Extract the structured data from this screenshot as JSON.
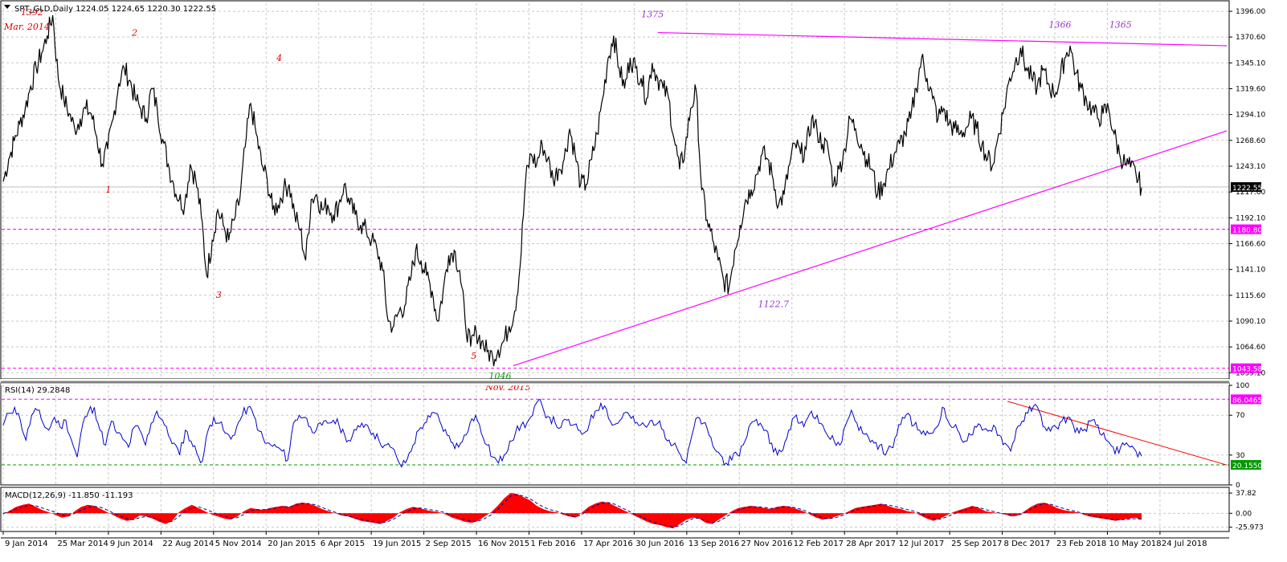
{
  "chart_data": [
    {
      "type": "line",
      "panel": "price",
      "header": "SPT_GLD,Daily  1224.05 1224.65 1220.30 1222.55",
      "ohlc": {
        "open": 1224.05,
        "high": 1224.65,
        "low": 1220.3,
        "close": 1222.55
      },
      "y_ticks": [
        "1396.00",
        "1370.60",
        "1345.10",
        "1319.60",
        "1294.10",
        "1268.60",
        "1243.10",
        "1217.60",
        "1192.10",
        "1166.60",
        "1141.10",
        "1115.60",
        "1090.10",
        "1064.60",
        "1039.10"
      ],
      "ylim": [
        1033,
        1404
      ],
      "grid": true,
      "x_ticks": [
        "9 Jan 2014",
        "25 Mar 2014",
        "9 Jun 2014",
        "22 Aug 2014",
        "5 Nov 2014",
        "20 Jan 2015",
        "6 Apr 2015",
        "19 Jun 2015",
        "2 Sep 2015",
        "16 Nov 2015",
        "1 Feb 2016",
        "17 Apr 2016",
        "30 Jun 2016",
        "13 Sep 2016",
        "27 Nov 2016",
        "12 Feb 2017",
        "28 Apr 2017",
        "12 Jul 2017",
        "25 Sep 2017",
        "8 Dec 2017",
        "23 Feb 2018",
        "10 May 2018",
        "24 Jul 2018"
      ],
      "series": [
        {
          "values": [
            1228,
            1250,
            1268,
            1285,
            1300,
            1322,
            1340,
            1355,
            1372,
            1392,
            1330,
            1310,
            1295,
            1280,
            1290,
            1300,
            1295,
            1272,
            1245,
            1260,
            1290,
            1325,
            1340,
            1328,
            1310,
            1300,
            1290,
            1320,
            1300,
            1270,
            1245,
            1225,
            1210,
            1205,
            1245,
            1230,
            1195,
            1135,
            1170,
            1200,
            1185,
            1170,
            1190,
            1210,
            1262,
            1305,
            1275,
            1245,
            1230,
            1200,
            1205,
            1220,
            1225,
            1195,
            1180,
            1150,
            1210,
            1215,
            1200,
            1205,
            1195,
            1205,
            1225,
            1205,
            1195,
            1185,
            1180,
            1170,
            1160,
            1140,
            1090,
            1085,
            1100,
            1105,
            1130,
            1160,
            1150,
            1135,
            1120,
            1090,
            1120,
            1155,
            1160,
            1140,
            1090,
            1065,
            1080,
            1070,
            1060,
            1055,
            1062,
            1070,
            1085,
            1100,
            1145,
            1230,
            1255,
            1245,
            1265,
            1250,
            1230,
            1240,
            1250,
            1280,
            1255,
            1225,
            1225,
            1250,
            1275,
            1310,
            1350,
            1372,
            1340,
            1320,
            1350,
            1340,
            1330,
            1310,
            1345,
            1330,
            1320,
            1310,
            1270,
            1240,
            1260,
            1300,
            1318,
            1220,
            1190,
            1170,
            1150,
            1130,
            1124,
            1160,
            1185,
            1210,
            1220,
            1235,
            1255,
            1250,
            1230,
            1205,
            1215,
            1245,
            1265,
            1255,
            1260,
            1290,
            1278,
            1265,
            1260,
            1225,
            1240,
            1260,
            1290,
            1280,
            1265,
            1250,
            1240,
            1215,
            1225,
            1240,
            1255,
            1265,
            1275,
            1290,
            1320,
            1350,
            1330,
            1310,
            1290,
            1300,
            1285,
            1280,
            1275,
            1280,
            1290,
            1280,
            1265,
            1250,
            1245,
            1275,
            1300,
            1330,
            1345,
            1360,
            1340,
            1330,
            1320,
            1338,
            1325,
            1315,
            1325,
            1350,
            1362,
            1335,
            1320,
            1308,
            1300,
            1290,
            1295,
            1300,
            1275,
            1255,
            1245,
            1242,
            1235,
            1222
          ]
        }
      ],
      "levels": [
        {
          "label": "1180.80",
          "value": 1180.8,
          "color": "#ff00ff"
        },
        {
          "label": "1043.58",
          "value": 1043.58,
          "color": "#ff00ff"
        }
      ],
      "current_price_label": "1222.55",
      "trendlines": [
        {
          "from": [
            12.45,
            1375
          ],
          "to": [
            24.3,
            1362
          ],
          "color": "#ff00ff"
        },
        {
          "from": [
            9.7,
            1046
          ],
          "to": [
            24.3,
            1278
          ],
          "color": "#ff00ff"
        }
      ],
      "annotations": [
        {
          "text": "1392",
          "at": [
            0.55,
            1392
          ],
          "color": "#dd0000"
        },
        {
          "text": "Mar. 2014",
          "at": [
            0.45,
            1378
          ],
          "color": "#dd0000"
        },
        {
          "text": "1375",
          "at": [
            12.35,
            1390
          ],
          "color": "#9933cc"
        },
        {
          "text": "1366",
          "at": [
            20.1,
            1380
          ],
          "color": "#9933cc"
        },
        {
          "text": "1365",
          "at": [
            21.25,
            1380
          ],
          "color": "#9933cc"
        },
        {
          "text": "2",
          "at": [
            2.5,
            1372
          ],
          "color": "#dd0000"
        },
        {
          "text": "4",
          "at": [
            5.25,
            1347
          ],
          "color": "#dd0000"
        },
        {
          "text": "1",
          "at": [
            2.0,
            1217
          ],
          "color": "#dd0000"
        },
        {
          "text": "3",
          "at": [
            4.1,
            1113
          ],
          "color": "#dd0000"
        },
        {
          "text": "5",
          "at": [
            8.95,
            1053
          ],
          "color": "#dd0000"
        },
        {
          "text": "1122.7",
          "at": [
            14.65,
            1104
          ],
          "color": "#9933cc"
        },
        {
          "text": "1046",
          "at": [
            9.45,
            1033
          ],
          "color": "#009900"
        },
        {
          "text": "Nov. 2015",
          "at": [
            9.6,
            1022
          ],
          "color": "#dd0000"
        }
      ]
    },
    {
      "type": "line",
      "panel": "rsi",
      "header": "RSI(14) 29.2848",
      "y_ticks": [
        "100",
        "70",
        "30",
        "0"
      ],
      "ylim": [
        0,
        100
      ],
      "levels": [
        {
          "label": "86.0465",
          "value": 86.0465,
          "color": "#ff00ff"
        },
        {
          "label": "20.1550",
          "value": 20.155,
          "color": "#009900"
        }
      ],
      "trendlines": [
        {
          "from": [
            19.1,
            84
          ],
          "to": [
            24.3,
            20
          ],
          "color": "#ff0000"
        }
      ],
      "series": [
        {
          "values": [
            60,
            72,
            78,
            65,
            45,
            70,
            75,
            62,
            55,
            68,
            58,
            65,
            45,
            28,
            62,
            74,
            78,
            55,
            40,
            64,
            52,
            46,
            38,
            58,
            55,
            40,
            62,
            74,
            65,
            50,
            42,
            30,
            55,
            44,
            32,
            24,
            55,
            68,
            62,
            52,
            46,
            58,
            70,
            78,
            70,
            54,
            42,
            40,
            38,
            34,
            25,
            62,
            70,
            68,
            58,
            55,
            60,
            62,
            65,
            60,
            50,
            44,
            55,
            62,
            60,
            52,
            45,
            40,
            38,
            30,
            18,
            26,
            40,
            55,
            62,
            68,
            72,
            60,
            50,
            42,
            38,
            50,
            62,
            70,
            52,
            40,
            28,
            22,
            30,
            44,
            52,
            60,
            62,
            70,
            85,
            74,
            68,
            62,
            58,
            65,
            60,
            55,
            52,
            62,
            74,
            82,
            76,
            60,
            62,
            72,
            70,
            62,
            60,
            58,
            65,
            62,
            55,
            45,
            42,
            30,
            22,
            50,
            68,
            62,
            50,
            36,
            30,
            22,
            25,
            30,
            40,
            58,
            64,
            62,
            55,
            42,
            30,
            35,
            55,
            68,
            62,
            64,
            74,
            70,
            60,
            48,
            44,
            40,
            60,
            75,
            62,
            52,
            48,
            42,
            40,
            30,
            38,
            50,
            68,
            72,
            60,
            55,
            50,
            52,
            58,
            78,
            64,
            58,
            52,
            44,
            50,
            58,
            55,
            54,
            60,
            50,
            42,
            34,
            56,
            64,
            72,
            79,
            74,
            58,
            54,
            58,
            64,
            68,
            60,
            52,
            56,
            64,
            60,
            50,
            44,
            38,
            32,
            40,
            38,
            34,
            29
          ]
        }
      ]
    },
    {
      "type": "area",
      "panel": "macd",
      "header": "MACD(12,26,9) -11.850 -11.193",
      "y_ticks": [
        "37.82",
        "0.00",
        "-25.973"
      ],
      "ylim": [
        -34,
        44
      ],
      "series": [
        {
          "values": [
            -2,
            5,
            12,
            16,
            18,
            12,
            6,
            2,
            -3,
            -8,
            -6,
            4,
            12,
            16,
            14,
            8,
            2,
            -4,
            -10,
            -14,
            -12,
            -4,
            -6,
            -10,
            -16,
            -20,
            -14,
            2,
            10,
            16,
            10,
            4,
            -2,
            -6,
            -10,
            -12,
            -6,
            4,
            10,
            8,
            6,
            10,
            12,
            14,
            12,
            18,
            20,
            18,
            14,
            8,
            4,
            0,
            -4,
            -6,
            -10,
            -14,
            -16,
            -18,
            -20,
            -14,
            -8,
            2,
            8,
            12,
            10,
            6,
            4,
            2,
            -2,
            -8,
            -12,
            -16,
            -18,
            -14,
            -6,
            2,
            14,
            28,
            38,
            36,
            30,
            24,
            14,
            8,
            4,
            2,
            -2,
            -6,
            -8,
            2,
            12,
            18,
            22,
            20,
            14,
            8,
            2,
            -4,
            -10,
            -16,
            -20,
            -22,
            -26,
            -28,
            -20,
            -12,
            -8,
            -10,
            -18,
            -20,
            -12,
            -4,
            4,
            10,
            12,
            14,
            12,
            10,
            8,
            12,
            14,
            12,
            8,
            4,
            -2,
            -8,
            -12,
            -10,
            -6,
            -2,
            4,
            10,
            12,
            14,
            16,
            18,
            14,
            10,
            8,
            4,
            2,
            -4,
            -10,
            -14,
            -10,
            -4,
            2,
            6,
            10,
            14,
            10,
            4,
            2,
            0,
            -2,
            -6,
            -4,
            4,
            12,
            18,
            20,
            16,
            10,
            6,
            4,
            2,
            -2,
            -6,
            -8,
            -10,
            -12,
            -14,
            -12,
            -10,
            -8,
            -12
          ]
        },
        {
          "values": [
            0,
            3,
            8,
            12,
            15,
            14,
            10,
            6,
            2,
            -3,
            -5,
            0,
            6,
            11,
            13,
            11,
            6,
            0,
            -5,
            -10,
            -12,
            -8,
            -6,
            -8,
            -12,
            -16,
            -15,
            -6,
            4,
            10,
            12,
            8,
            3,
            -2,
            -6,
            -9,
            -8,
            -2,
            5,
            7,
            7,
            8,
            10,
            12,
            12,
            15,
            18,
            18,
            16,
            11,
            6,
            2,
            -2,
            -5,
            -8,
            -11,
            -14,
            -16,
            -18,
            -16,
            -11,
            -4,
            3,
            8,
            10,
            8,
            6,
            4,
            1,
            -4,
            -8,
            -12,
            -15,
            -15,
            -10,
            -3,
            7,
            20,
            32,
            35,
            32,
            27,
            19,
            12,
            7,
            4,
            0,
            -4,
            -7,
            -2,
            7,
            14,
            19,
            20,
            17,
            11,
            5,
            -1,
            -6,
            -12,
            -17,
            -20,
            -23,
            -26,
            -23,
            -16,
            -10,
            -9,
            -14,
            -18,
            -15,
            -8,
            0,
            6,
            10,
            12,
            12,
            11,
            9,
            10,
            12,
            12,
            10,
            6,
            1,
            -4,
            -9,
            -10,
            -8,
            -4,
            1,
            6,
            10,
            12,
            14,
            16,
            16,
            13,
            10,
            7,
            4,
            0,
            -6,
            -10,
            -11,
            -7,
            -2,
            3,
            7,
            11,
            11,
            7,
            4,
            1,
            -1,
            -4,
            -4,
            1,
            8,
            14,
            18,
            17,
            13,
            9,
            6,
            3,
            0,
            -4,
            -6,
            -8,
            -10,
            -12,
            -12,
            -11,
            -10,
            -11
          ]
        }
      ]
    }
  ]
}
